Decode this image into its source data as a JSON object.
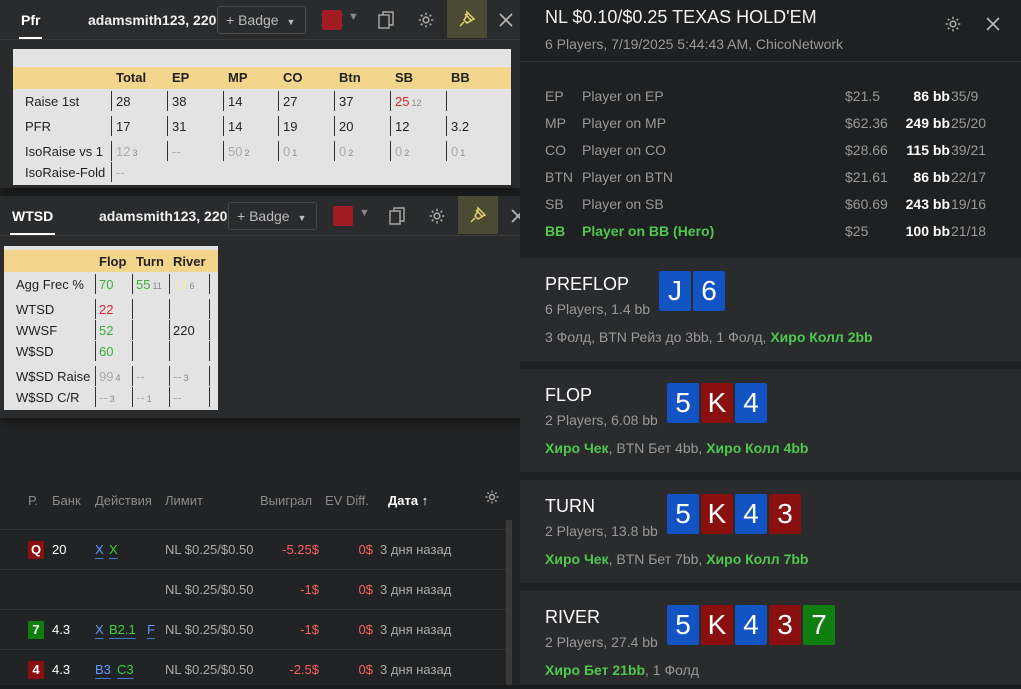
{
  "hand_list": {
    "columns": [
      "Р.",
      "Банк",
      "Действия",
      "Лимит",
      "Выиграл",
      "EV Diff.",
      "Дата ↑"
    ],
    "rows": [
      {
        "card": "Q",
        "card_color": "#8a1010",
        "pot": "20",
        "actions": [
          {
            "t": "X",
            "c": "blue"
          },
          {
            "t": "X",
            "c": "green"
          }
        ],
        "limit": "NL $0.25/$0.50",
        "won": "-5.25$",
        "ev": "0$",
        "date": "3 дня назад"
      },
      {
        "card": "",
        "card_color": "",
        "pot": "",
        "actions": [],
        "limit": "NL $0.25/$0.50",
        "won": "-1$",
        "ev": "0$",
        "date": "3 дня назад"
      },
      {
        "card": "7",
        "card_color": "#0e7f0e",
        "pot": "4.3",
        "actions": [
          {
            "t": "X",
            "c": "blue"
          },
          {
            "t": "B2.1",
            "c": "green"
          },
          {
            "t": "F",
            "c": "blue"
          }
        ],
        "limit": "NL $0.25/$0.50",
        "won": "-1$",
        "ev": "0$",
        "date": "3 дня назад"
      },
      {
        "card": "4",
        "card_color": "#8a1010",
        "pot": "4.3",
        "actions": [
          {
            "t": "B3",
            "c": "blue"
          },
          {
            "t": "C3",
            "c": "green"
          }
        ],
        "limit": "NL $0.25/$0.50",
        "won": "-2.5$",
        "ev": "0$",
        "date": "3 дня назад"
      }
    ]
  },
  "popup_pfr": {
    "tab": "Pfr",
    "user": "adamsmith123, 220",
    "badge_label": "+ Badge",
    "headers": [
      "Total",
      "EP",
      "MP",
      "CO",
      "Btn",
      "SB",
      "BB"
    ],
    "rows": [
      {
        "label": "Raise 1st",
        "cells": [
          "28",
          "38",
          "14",
          "27",
          "37",
          "25",
          ""
        ],
        "subs": [
          "",
          "",
          "",
          "",
          "",
          "12",
          ""
        ]
      },
      {
        "label": "PFR",
        "cells": [
          "17",
          "31",
          "14",
          "19",
          "20",
          "12",
          "3.2"
        ],
        "subs": [
          "",
          "",
          "",
          "",
          "",
          "",
          ""
        ]
      },
      {
        "label": "IsoRaise vs 1",
        "cells": [
          "12",
          "--",
          "50",
          "0",
          "0",
          "0",
          "0"
        ],
        "subs": [
          "3",
          "",
          "2",
          "1",
          "2",
          "2",
          "1"
        ]
      },
      {
        "label": "IsoRaise-Fold",
        "cells": [
          "--",
          "",
          "",
          "",
          "",
          "",
          ""
        ],
        "subs": [
          "",
          "",
          "",
          "",
          "",
          "",
          ""
        ]
      }
    ]
  },
  "popup_wtsd": {
    "tab": "WTSD",
    "user": "adamsmith123, 220",
    "badge_label": "+ Badge",
    "headers": [
      "Flop",
      "Turn",
      "River"
    ],
    "rows": [
      {
        "label": "Agg Frec %",
        "cells": [
          "70",
          "55",
          "14"
        ],
        "subs": [
          "",
          "11",
          "6"
        ]
      },
      {
        "label": "WTSD",
        "cells": [
          "22",
          "",
          ""
        ],
        "subs": [
          "",
          "",
          ""
        ]
      },
      {
        "label": "WWSF",
        "cells": [
          "52",
          "",
          "220"
        ],
        "subs": [
          "",
          "",
          ""
        ]
      },
      {
        "label": "W$SD",
        "cells": [
          "60",
          "",
          ""
        ],
        "subs": [
          "",
          "",
          ""
        ]
      },
      {
        "label": "W$SD Raise",
        "cells": [
          "99",
          "--",
          "--"
        ],
        "subs": [
          "4",
          "",
          "3"
        ]
      },
      {
        "label": "W$SD C/R",
        "cells": [
          "--",
          "--",
          "--"
        ],
        "subs": [
          "3",
          "1",
          ""
        ]
      }
    ]
  },
  "hand": {
    "title": "NL $0.10/$0.25 TEXAS HOLD'EM",
    "subtitle": "6 Players, 7/19/2025 5:44:43 AM, ChicoNetwork",
    "players": [
      {
        "pos": "EP",
        "name": "Player on EP",
        "stack": "$21.5",
        "bb": "86 bb",
        "ratio": "35/9",
        "hero": false
      },
      {
        "pos": "MP",
        "name": "Player on MP",
        "stack": "$62.36",
        "bb": "249 bb",
        "ratio": "25/20",
        "hero": false
      },
      {
        "pos": "CO",
        "name": "Player on CO",
        "stack": "$28.66",
        "bb": "115 bb",
        "ratio": "39/21",
        "hero": false
      },
      {
        "pos": "BTN",
        "name": "Player on BTN",
        "stack": "$21.61",
        "bb": "86 bb",
        "ratio": "22/17",
        "hero": false
      },
      {
        "pos": "SB",
        "name": "Player on SB",
        "stack": "$60.69",
        "bb": "243 bb",
        "ratio": "19/16",
        "hero": false
      },
      {
        "pos": "BB",
        "name": "Player on BB (Hero)",
        "stack": "$25",
        "bb": "100 bb",
        "ratio": "21/18",
        "hero": true
      }
    ],
    "streets": [
      {
        "name": "PREFLOP",
        "info": "6 Players, 1.4 bb",
        "cards": [
          {
            "r": "J",
            "c": "blue"
          },
          {
            "r": "6",
            "c": "blue"
          }
        ],
        "actions": [
          {
            "t": "3 Фолд, BTN Рейз до 3bb, 1 Фолд, ",
            "hero": false
          },
          {
            "t": "Хиро Колл 2bb",
            "hero": true
          }
        ]
      },
      {
        "name": "FLOP",
        "info": "2 Players, 6.08 bb",
        "cards": [
          {
            "r": "5",
            "c": "blue"
          },
          {
            "r": "K",
            "c": "red"
          },
          {
            "r": "4",
            "c": "blue"
          }
        ],
        "actions": [
          {
            "t": "Хиро Чек",
            "hero": true
          },
          {
            "t": ", BTN Бет 4bb, ",
            "hero": false
          },
          {
            "t": "Хиро Колл 4bb",
            "hero": true
          }
        ]
      },
      {
        "name": "TURN",
        "info": "2 Players, 13.8 bb",
        "cards": [
          {
            "r": "5",
            "c": "blue"
          },
          {
            "r": "K",
            "c": "red"
          },
          {
            "r": "4",
            "c": "blue"
          },
          {
            "r": "3",
            "c": "red"
          }
        ],
        "actions": [
          {
            "t": "Хиро Чек",
            "hero": true
          },
          {
            "t": ", BTN Бет 7bb, ",
            "hero": false
          },
          {
            "t": "Хиро Колл 7bb",
            "hero": true
          }
        ]
      },
      {
        "name": "RIVER",
        "info": "2 Players, 27.4 bb",
        "cards": [
          {
            "r": "5",
            "c": "blue"
          },
          {
            "r": "K",
            "c": "red"
          },
          {
            "r": "4",
            "c": "blue"
          },
          {
            "r": "3",
            "c": "red"
          },
          {
            "r": "7",
            "c": "green"
          }
        ],
        "actions": [
          {
            "t": "Хиро Бет 21bb",
            "hero": true
          },
          {
            "t": ", 1 Фолд",
            "hero": false
          }
        ]
      }
    ]
  },
  "colors": {
    "hero_green": "#4ec94e",
    "card_blue": "#1354c4",
    "card_red": "#8a1010",
    "card_green": "#0e7f0e",
    "stat_header": "#f3d58c",
    "pin_bg": "#4b4a32"
  },
  "icons": [
    "gear-icon",
    "close-icon",
    "copy-icon",
    "pin-icon",
    "chevron-down-icon",
    "sort-arrow-icon"
  ]
}
